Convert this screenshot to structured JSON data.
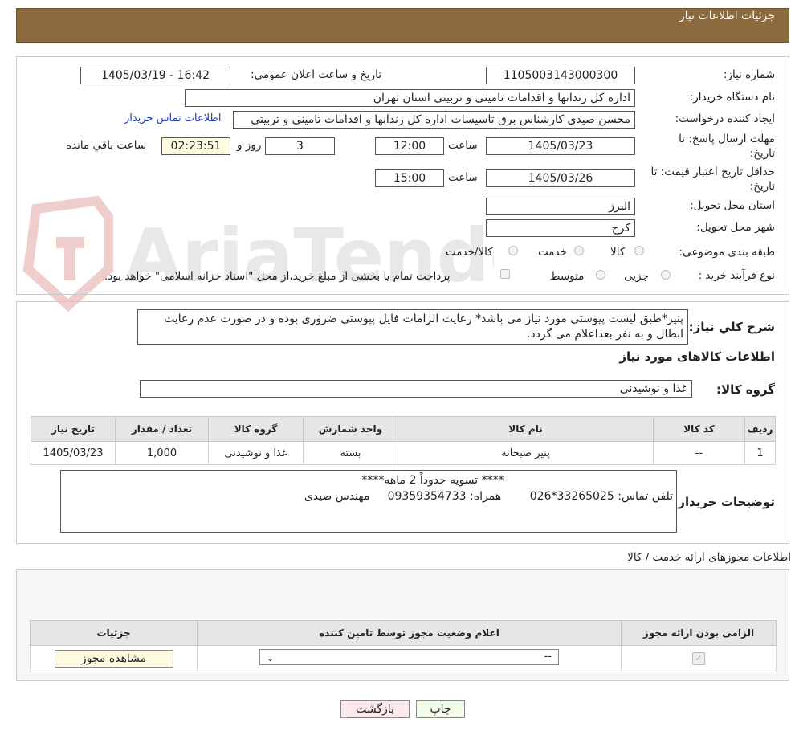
{
  "header": {
    "title": "جزئیات اطلاعات نیاز"
  },
  "watermark": {
    "text": "AriaTender.neT"
  },
  "need_info": {
    "need_number_label": "شماره نیاز:",
    "need_number": "1105003143000300",
    "announce_label": "تاریخ و ساعت اعلان عمومی:",
    "announce_value": "1405/03/19 - 16:42",
    "buyer_org_label": "نام دستگاه خریدار:",
    "buyer_org": "اداره کل زندانها و اقدامات تامینی و تربیتی استان تهران",
    "requester_label": "ایجاد کننده درخواست:",
    "requester": "محسن صیدی کارشناس برق تاسیسات  اداره کل زندانها و اقدامات تامینی و تربیتی",
    "contact_link": "اطلاعات تماس خریدار",
    "deadline_label": "مهلت ارسال پاسخ: تا",
    "deadline_label2": "تاریخ:",
    "deadline_date": "1405/03/23",
    "time_label": "ساعت",
    "deadline_time": "12:00",
    "days_value": "3",
    "days_label": "روز و",
    "remaining_value": "02:23:51",
    "remaining_label": "ساعت باقي مانده",
    "validity_label": "حداقل تاریخ اعتبار قیمت: تا",
    "validity_label2": "تاریخ:",
    "validity_date": "1405/03/26",
    "validity_time": "15:00",
    "province_label": "استان محل تحویل:",
    "province": "البرز",
    "city_label": "شهر محل تحویل:",
    "city": "کرج",
    "category_label": "طبقه بندی موضوعی:",
    "category_options": [
      "کالا",
      "خدمت",
      "کالا/خدمت"
    ],
    "process_label": "نوع فرآیند خرید :",
    "process_options": [
      "جزیی",
      "متوسط"
    ],
    "process_note": "پرداخت تمام یا بخشی از مبلغ خرید،از محل \"اسناد خزانه اسلامی\" خواهد بود."
  },
  "description": {
    "label": "شرح کلي نياز:",
    "text": "پنیر*طبق لیست پیوستی مورد نیاز می باشد* رعایت الزامات فایل پیوستی ضروری بوده و در صورت عدم رعایت ابطال و به نفر بعداعلام می گردد.",
    "goods_info_title": "اطلاعات کالاهای مورد نیاز",
    "goods_group_label": "گروه کالا:",
    "goods_group": "غذا و نوشیدنی"
  },
  "items_table": {
    "headers": [
      "ردیف",
      "کد کالا",
      "نام کالا",
      "واحد شمارش",
      "گروه کالا",
      "تعداد / مقدار",
      "تاریخ نیاز"
    ],
    "rows": [
      [
        "1",
        "--",
        "پنیر صبحانه",
        "بسته",
        "غذا و نوشیدنی",
        "1,000",
        "1405/03/23"
      ]
    ]
  },
  "buyer_notes": {
    "label": "توضیحات خریدار:",
    "line1": "**** تسویه حدوداً 2 ماهه****",
    "line2": "تلفن تماس: 33265025*026        همراه: 09359354733     مهندس صیدی"
  },
  "permits": {
    "section_title": "اطلاعات مجوزهای ارائه خدمت / کالا",
    "headers": [
      "الزامی بودن ارائه مجوز",
      "اعلام وضعیت مجوز توسط تامین کننده",
      "جزئیات"
    ],
    "select_value": "--",
    "view_button": "مشاهده مجوز"
  },
  "footer": {
    "print_button": "چاپ",
    "back_button": "بازگشت"
  }
}
